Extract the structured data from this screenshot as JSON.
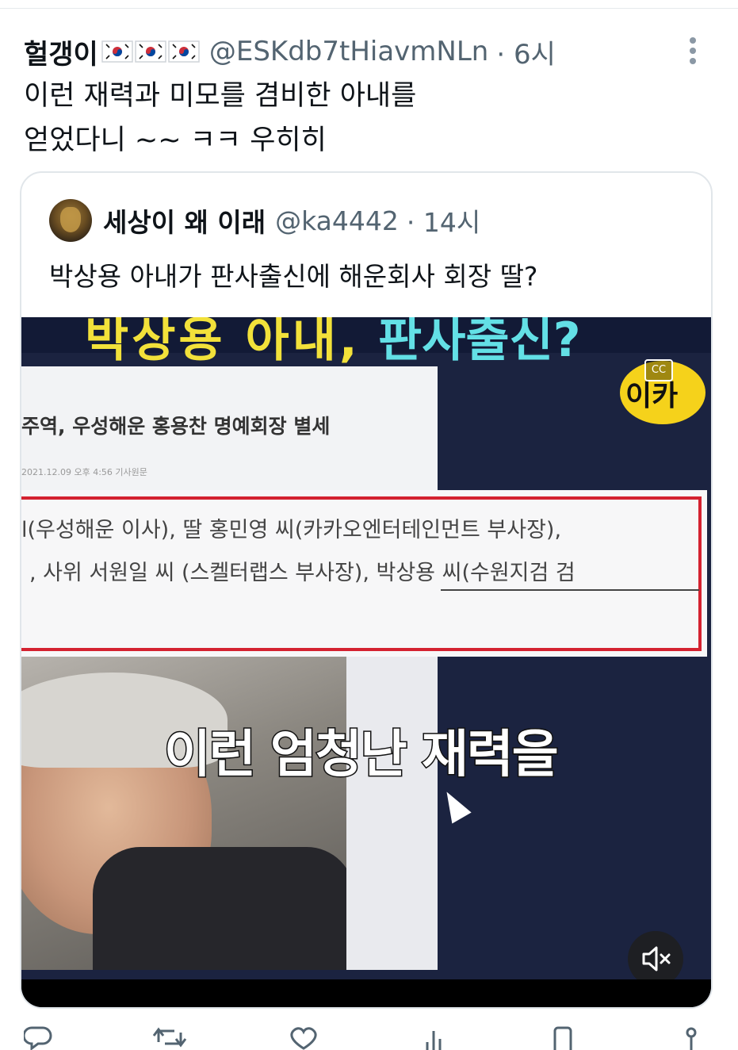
{
  "tweet": {
    "author_name": "헐갱이",
    "author_handle": "@ESKdb7tHiavmNLn",
    "time": "· 6시",
    "flags": [
      "korea-flag-icon",
      "korea-flag-icon",
      "korea-flag-icon"
    ],
    "text_lines": [
      "이런 재력과 미모를 겸비한 아내를",
      "얻었다니 ~~ ㅋㅋ 우히히"
    ]
  },
  "quoted": {
    "author_name": "세상이 왜 이래",
    "author_handle": "@ka4442",
    "time": "· 14시",
    "text": "박상용 아내가 판사출신에 해운회사 회장 딸?",
    "video": {
      "headline_left": "박상용 아내,",
      "headline_right": "판사출신?",
      "article_title": "주역, 우성해운 홍용찬 명예회장 별세",
      "article_date": "2021.12.09 오후 4:56 기사원문",
      "line1": "l(우성해운 이사), 딸 홍민영 씨(카카오엔터테인먼트 부사장),",
      "line2_prefix": ", 사위 서원일 씨 (스켈터랩스 부사장),",
      "line2_highlight": "박상용 씨(수원지검 검",
      "caption": "이런 엄청난 재력을",
      "logo": "이카",
      "cc_label": "CC"
    }
  },
  "colors": {
    "text": "#0f1419",
    "secondary": "#536471",
    "card_border": "#e1e6ea",
    "red_box": "#d42230",
    "logo_yellow": "#f5d21b"
  }
}
